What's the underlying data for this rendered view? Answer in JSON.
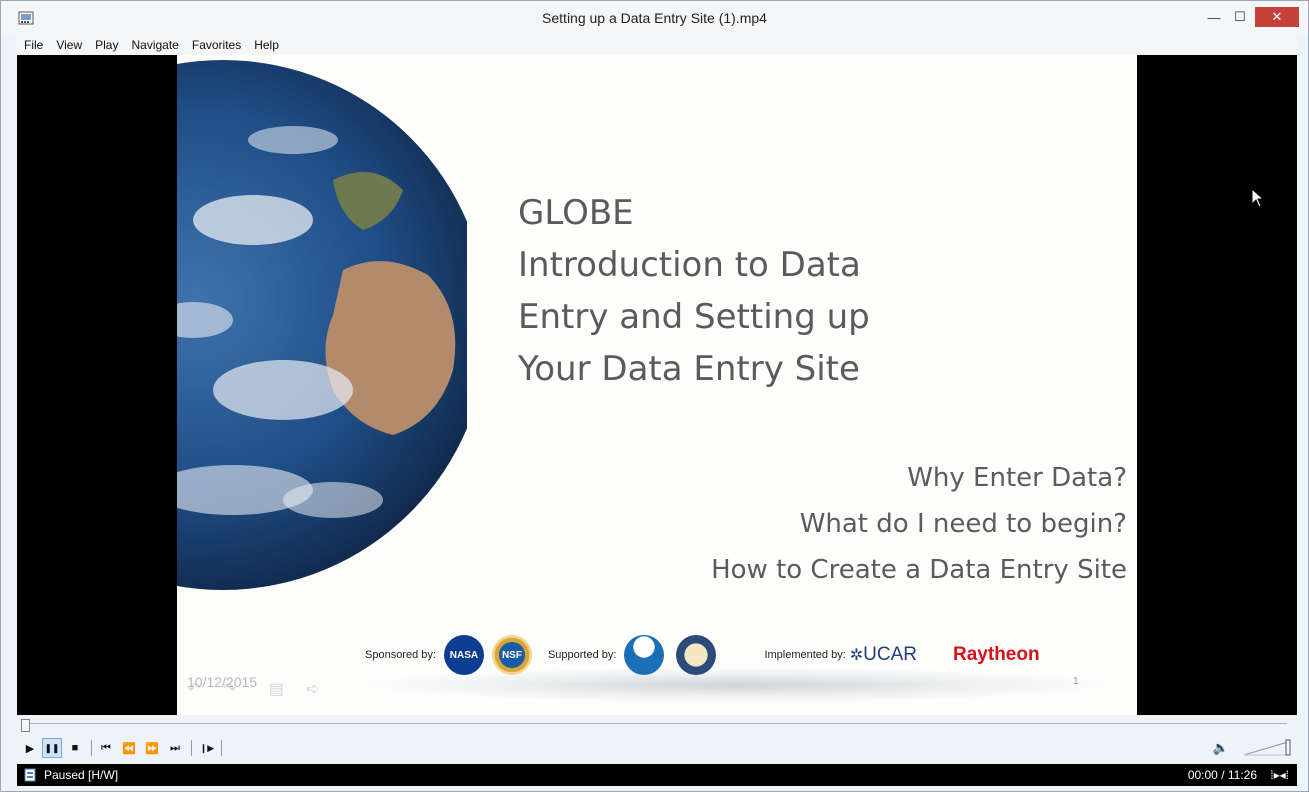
{
  "window": {
    "title": "Setting up a Data Entry Site (1).mp4",
    "minimize_glyph": "—",
    "maximize_glyph": "☐",
    "close_glyph": "✕"
  },
  "menu": [
    "File",
    "View",
    "Play",
    "Navigate",
    "Favorites",
    "Help"
  ],
  "slide": {
    "title_lines": [
      "GLOBE",
      "Introduction to Data",
      "Entry and Setting up",
      "Your Data Entry Site"
    ],
    "bullets": [
      "Why Enter Data?",
      "What do I need to begin?",
      "How to Create a Data Entry Site"
    ],
    "sponsored_by": "Sponsored by:",
    "supported_by": "Supported by:",
    "implemented_by": "Implemented by:",
    "ucar": "UCAR",
    "raytheon": "Raytheon",
    "nasa": "NASA",
    "nsf": "NSF",
    "date": "10/12/2015",
    "page_number": "1"
  },
  "playback": {
    "progress_fraction": 0.0,
    "play_glyph": "▶",
    "pause_glyph": "❚❚",
    "stop_glyph": "■",
    "prev_glyph": "⏮",
    "rewind_glyph": "⏪",
    "forward_glyph": "⏩",
    "next_glyph": "⏭",
    "frame_step_glyph": "❙▶",
    "volume_glyph": "🔈"
  },
  "status": {
    "state": "Paused [H/W]",
    "time": "00:00 / 11:26",
    "eq_glyph": "⁞▸◂⁞"
  },
  "colors": {
    "close_red": "#c7413b",
    "raytheon_red": "#d4121c",
    "active_button": "#cde3f7"
  }
}
